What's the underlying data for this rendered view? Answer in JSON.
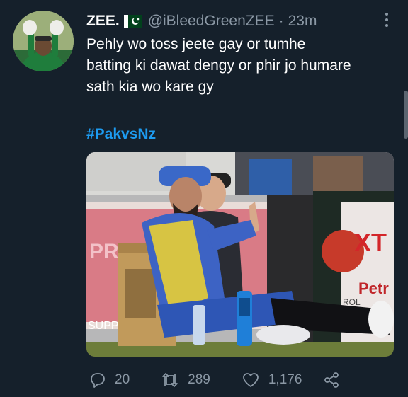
{
  "tweet": {
    "display_name": "ZEE.",
    "handle": "@iBleedGreenZEE",
    "separator": "·",
    "time": "23m",
    "text_lines": [
      "Pehly wo toss jeete gay or tumhe",
      "batting ki dawat dengy or phir jo humare",
      "sath kia wo kare gy"
    ],
    "hashtag": "#PakvsNz",
    "media_text": {
      "bag_label": "SUPP",
      "board_left": "PREM",
      "board_right_1": "XT",
      "board_right_2": "Petr",
      "board_right_3": "ROL"
    }
  },
  "actions": {
    "reply_count": "20",
    "retweet_count": "289",
    "like_count": "1,176"
  },
  "colors": {
    "background": "#15202b",
    "secondary_text": "#8b98a5",
    "link": "#1d9bf0"
  },
  "icons": [
    "more-options-icon",
    "pakistan-flag-icon",
    "reply-icon",
    "retweet-icon",
    "like-icon",
    "share-icon"
  ]
}
